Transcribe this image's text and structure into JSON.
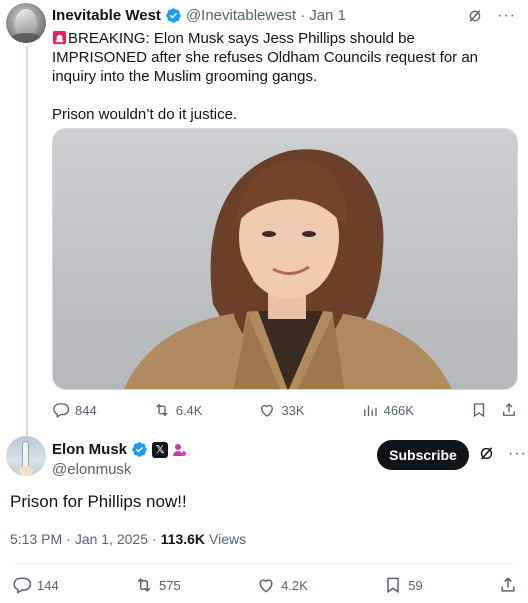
{
  "parent_tweet": {
    "author_name": "Inevitable West",
    "handle": "@Inevitablewest",
    "separator": "·",
    "date": "Jan 1",
    "text_headline": "BREAKING: Elon Musk says Jess Phillips should be IMPRISONED after she refuses Oldham Councils request for an inquiry into the Muslim grooming gangs.",
    "text_followup": "Prison wouldn’t do it justice.",
    "stats": {
      "replies": "844",
      "reposts": "6.4K",
      "likes": "33K",
      "views": "466K"
    }
  },
  "main_tweet": {
    "author_name": "Elon Musk",
    "handle": "@elonmusk",
    "subscribe_label": "Subscribe",
    "text": "Prison for Phillips now!!",
    "time": "5:13 PM",
    "separator": "·",
    "date": "Jan 1, 2025",
    "separator2": "·",
    "views": "113.6K",
    "views_label": "Views",
    "stats": {
      "replies": "144",
      "reposts": "575",
      "likes": "4.2K",
      "bookmarks": "59"
    }
  },
  "colors": {
    "accent": "#1d9bf0",
    "text": "#0f1419",
    "muted": "#536471",
    "siren": "#e0245e",
    "affiliate": "#c837ab"
  },
  "icons": [
    "verified-icon",
    "siren-icon",
    "grok-icon",
    "more-icon",
    "reply-icon",
    "repost-icon",
    "like-icon",
    "views-icon",
    "bookmark-icon",
    "share-icon",
    "x-badge-icon",
    "affiliate-icon"
  ]
}
